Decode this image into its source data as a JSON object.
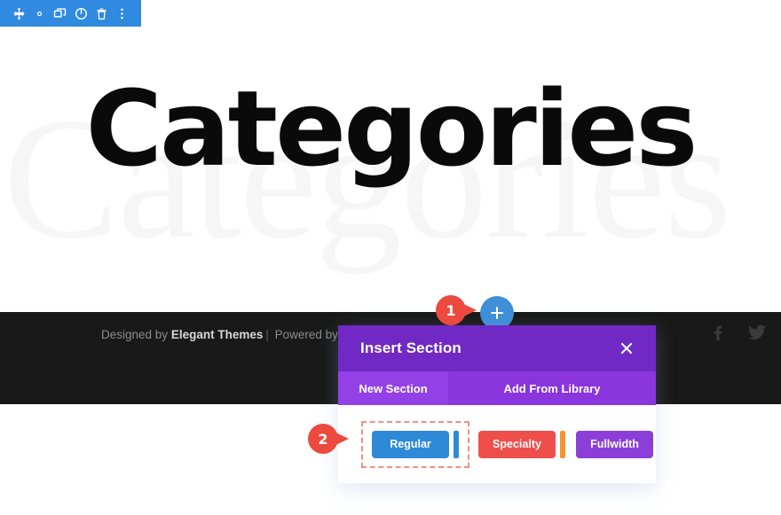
{
  "admin_toolbar": {
    "background": "#2f8ae0",
    "icons": [
      {
        "name": "move-icon",
        "label": "Move"
      },
      {
        "name": "gear-icon",
        "label": "Settings"
      },
      {
        "name": "duplicate-icon",
        "label": "Duplicate"
      },
      {
        "name": "power-icon",
        "label": "Disable"
      },
      {
        "name": "trash-icon",
        "label": "Delete"
      },
      {
        "name": "more-vertical-icon",
        "label": "More Options"
      }
    ]
  },
  "hero": {
    "title": "Categories",
    "watermark": "Categories",
    "title_color": "#0a0a0a",
    "watermark_color": "#f6f6f6",
    "background": "#ffffff"
  },
  "footer": {
    "background": "#191919",
    "credit_prefix": "Designed by ",
    "credit_brand": "Elegant Themes",
    "credit_separator": "|",
    "credit_suffix": " Powered by W",
    "social": [
      {
        "name": "facebook-icon",
        "label": "Facebook"
      },
      {
        "name": "twitter-icon",
        "label": "Twitter"
      }
    ]
  },
  "add_button": {
    "name": "add-section-plus-button",
    "label": "+",
    "color": "#3f8fd9"
  },
  "callouts": [
    {
      "number": "1",
      "color": "#ec4a3e"
    },
    {
      "number": "2",
      "color": "#ec4a3e"
    }
  ],
  "modal": {
    "title": "Insert Section",
    "close_label": "Close",
    "header_color": "#7029c4",
    "tabs": [
      {
        "label": "New Section",
        "active": true,
        "color": "#9341e6"
      },
      {
        "label": "Add From Library",
        "active": false,
        "color": "#8a35dd"
      }
    ],
    "section_types": [
      {
        "label": "Regular",
        "color": "#2e8ad6",
        "selected": true
      },
      {
        "label": "Specialty",
        "color": "#ef4f4a",
        "selected": false
      },
      {
        "label": "Fullwidth",
        "color": "#8b3fd8",
        "selected": false
      }
    ],
    "selection_outline_color": "#f28f84",
    "accent_strips": [
      {
        "name": "regular-strip",
        "color": "#2e8ad6"
      },
      {
        "name": "specialty-strip",
        "color": "#f59331"
      }
    ]
  }
}
